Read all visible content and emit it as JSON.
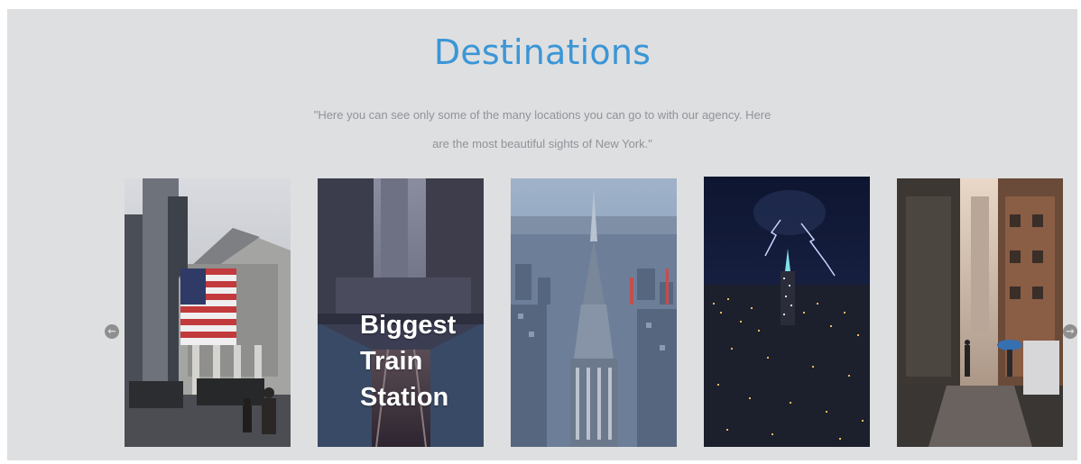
{
  "section": {
    "title": "Destinations",
    "subtitle_line1": "\"Here you can see only some of the many locations you can go to with our agency. Here",
    "subtitle_line2": "are the most beautiful sights of New York.\""
  },
  "carousel": {
    "prev_icon": "arrow-left-circle-icon",
    "next_icon": "arrow-right-circle-icon",
    "prev_glyph": "←",
    "next_glyph": "→",
    "cards": [
      {
        "image": "new-york-stock-exchange-photo",
        "caption": ""
      },
      {
        "image": "train-station-photo",
        "caption": "Biggest\nTrain\nStation"
      },
      {
        "image": "chrysler-building-photo",
        "caption": ""
      },
      {
        "image": "empire-state-lightning-photo",
        "caption": ""
      },
      {
        "image": "rainy-street-photo",
        "caption": ""
      }
    ]
  },
  "colors": {
    "background": "#dedfe1",
    "title": "#3b96d6",
    "subtitle": "#8f9398",
    "arrow": "#8f8f8f"
  }
}
